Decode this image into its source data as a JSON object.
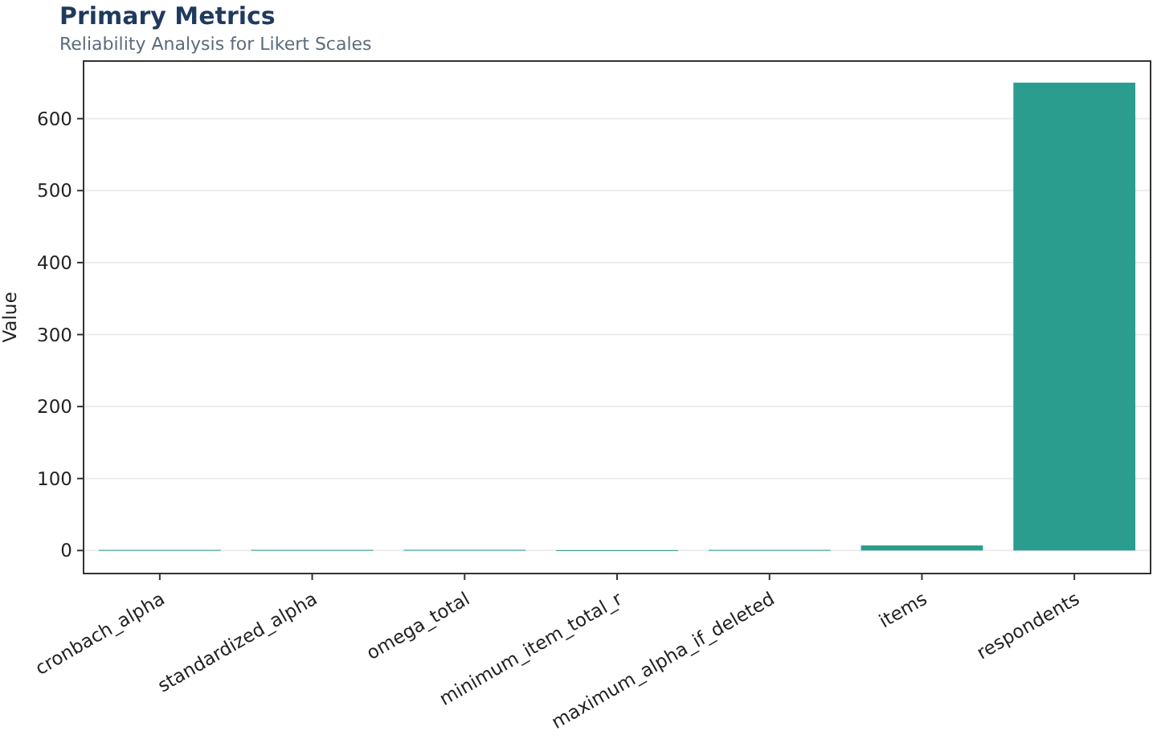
{
  "title": "Primary Metrics",
  "subtitle": "Reliability Analysis for Likert Scales",
  "chart_data": {
    "type": "bar",
    "ylabel": "Value",
    "categories": [
      "cronbach_alpha",
      "standardized_alpha",
      "omega_total",
      "minimum_item_total_r",
      "maximum_alpha_if_deleted",
      "items",
      "respondents"
    ],
    "values": [
      0.8,
      0.8,
      0.9,
      0.5,
      0.8,
      7,
      650
    ],
    "color": "#2a9d8f",
    "ylim": [
      -32,
      680
    ],
    "yticks": [
      0,
      100,
      200,
      300,
      400,
      500,
      600
    ],
    "grid": true
  }
}
